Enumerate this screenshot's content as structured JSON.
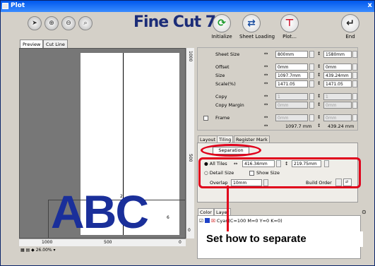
{
  "window": {
    "title": "Plot",
    "close": "x"
  },
  "toolbar": {
    "zoom_icons": [
      "pointer-icon",
      "zoom-in-icon",
      "zoom-out-icon",
      "zoom-fit-icon"
    ],
    "logo": "Fine Cut 7",
    "buttons": [
      {
        "label": "Initialize",
        "icon": "refresh-icon",
        "color": "#1a9a2a"
      },
      {
        "label": "Sheet Loading",
        "icon": "swap-icon",
        "color": "#1a4ea0"
      },
      {
        "label": "Plot...",
        "icon": "plot-icon",
        "color": "#d0102a"
      },
      {
        "label": "End",
        "icon": "return-icon",
        "color": "#222222"
      }
    ]
  },
  "preview": {
    "tabs": [
      "Preview",
      "Cut Line"
    ],
    "text": "ABC",
    "ruler_x": [
      "1000",
      "500",
      "0"
    ],
    "ruler_y": [
      "1000",
      "500",
      "0"
    ],
    "zoom": "26.00%",
    "tile_numbers": [
      "2",
      "4",
      "6"
    ]
  },
  "props": {
    "sheet_size": {
      "label": "Sheet Size",
      "w": "800mm",
      "h": "1580mm"
    },
    "offset": {
      "label": "Offset",
      "w": "0mm",
      "h": "0mm"
    },
    "size": {
      "label": "Size",
      "w": "1097.7mm",
      "h": "439.24mm"
    },
    "scale": {
      "label": "Scale(%)",
      "w": "1471.05",
      "h": "1471.05"
    },
    "copy": {
      "label": "Copy",
      "w": "1",
      "h": "1"
    },
    "copy_margin": {
      "label": "Copy Margin",
      "w": "0mm",
      "h": "0mm"
    },
    "frame": {
      "label": "Frame",
      "w": "0mm",
      "h": "0mm"
    },
    "totals": {
      "w": "1097.7 mm",
      "h": "439.24 mm"
    }
  },
  "tiling": {
    "tabs": [
      "Layout",
      "Tiling",
      "Register Mark"
    ],
    "separation_button": "Separation",
    "all_tiles": "All Tiles",
    "tile_w": "416.34mm",
    "tile_h": "219.75mm",
    "detail_size": "Detail Size",
    "show_size": "Show Size",
    "overlap_label": "Overlap",
    "overlap_value": "10mm",
    "build_order_label": "Build Order"
  },
  "layers": {
    "tabs": [
      "Color",
      "Layer"
    ],
    "row": "Cyan(C=100 M=0 Y=0 K=0)",
    "swatch_color": "#1f43c8"
  },
  "callout": "Set how to separate",
  "accent": "#e0001b"
}
